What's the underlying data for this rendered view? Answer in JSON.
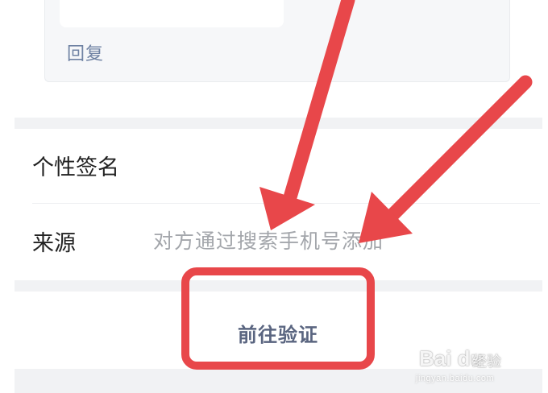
{
  "reply_card": {
    "reply_label": "回复"
  },
  "profile": {
    "signature_label": "个性签名",
    "source_label": "来源",
    "source_value": "对方通过搜索手机号添加"
  },
  "actions": {
    "verify_label": "前往验证"
  },
  "watermark": {
    "logo": "Bai du",
    "sub": "经验",
    "url": "jingyan.baidu.com"
  },
  "colors": {
    "annotation": "#e8474a",
    "link": "#6f82a3",
    "muted_text": "#a3a6ab",
    "separator": "#f1f2f4"
  }
}
